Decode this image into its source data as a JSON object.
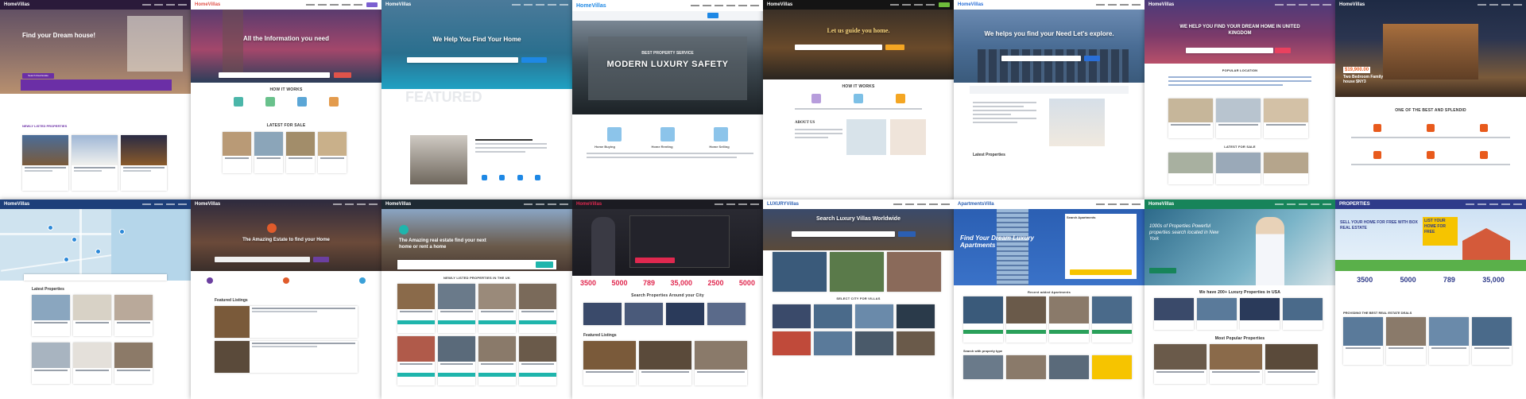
{
  "tiles": [
    {
      "logo": "HomeVillas",
      "title": "Find your Dream house!",
      "section": "NEWLY LISTED PROPERTIES",
      "btn": "Search Real Estate",
      "accent": "#6b2fa6"
    },
    {
      "logo": "HomeVillas",
      "title": "All the Information you need",
      "section": "HOW IT WORKS",
      "section2": "LATEST FOR SALE",
      "accent": "#e0534a"
    },
    {
      "logo": "HomeVillas",
      "title": "We Help You Find Your Home",
      "section": "FEATURED",
      "accent": "#1e88e5"
    },
    {
      "logo": "HomeVillas",
      "title": "MODERN LUXURY SAFETY",
      "kicker": "BEST PROPERTY SERVICE",
      "labels": [
        "Home Buying",
        "Home Renting",
        "Home Selling"
      ],
      "accent": "#1e88e5"
    },
    {
      "logo": "HomeVillas",
      "title": "Let us guide you home.",
      "section": "HOW IT WORKS",
      "section2": "ABOUT US",
      "accent": "#f4a623"
    },
    {
      "logo": "HomeVillas",
      "title": "We helps you find your Need Let's explore.",
      "section": "Latest Properties",
      "accent": "#2a6fd8"
    },
    {
      "logo": "HomeVillas",
      "title": "WE HELP YOU FIND YOUR DREAM HOME IN UNITED KINGDOM",
      "section": "POPULAR LOCATION",
      "section2": "LATEST FOR SALE",
      "accent": "#e9415f"
    },
    {
      "logo": "HomeVillas",
      "price": "$19,900.00",
      "title": "Two Bedroom Family house $NY3",
      "section": "ONE OF THE BEST AND SPLENDID",
      "accent": "#e85a1c"
    },
    {
      "logo": "HomeVillas",
      "section": "Latest Properties",
      "accent": "#2b88d8"
    },
    {
      "logo": "HomeVillas",
      "title": "The Amazing Estate to find your Home",
      "section": "Featured Listings",
      "accent": "#e05b2b"
    },
    {
      "logo": "HomeVillas",
      "title": "The Amazing real estate find your next home or rent a home",
      "section": "NEWLY LISTED PROPERTIES IN THE UK",
      "accent": "#1fb5ac"
    },
    {
      "logo": "HomeVillas",
      "stats": [
        "3500",
        "5000",
        "789",
        "35,000",
        "2500",
        "5000"
      ],
      "section": "Search Properties Around your City",
      "section2": "Featured Listings",
      "accent": "#e0284f"
    },
    {
      "logo": "LUXURYVillas",
      "title": "Search Luxury Villas Worldwide",
      "section": "SELECT CITY FOR VILLAS",
      "accent": "#2b5fb3"
    },
    {
      "logo": "ApartmentsVilla",
      "title": "Find Your Dream Luxury Apartments",
      "side": "Search Apartments",
      "section": "Recent added Apartments",
      "section2": "Search with property type",
      "accent": "#f6c400"
    },
    {
      "logo": "HomeVillas",
      "title": "1000s of Properties Powerful properties search located in New York",
      "section": "We have 200+ Luxury Properties in USA",
      "section2": "Most Popular Properties",
      "accent": "#17845a"
    },
    {
      "logo": "PROPERTIES",
      "title": "SELL YOUR HOME FOR FREE WITH BOX REAL ESTATE",
      "badge": "LIST YOUR HOME FOR FREE",
      "stats": [
        "3500",
        "5000",
        "789",
        "35,000"
      ],
      "section": "PROVIDING THE BEST REAL ESTATE DEALS",
      "accent": "#2f3b8a"
    }
  ]
}
